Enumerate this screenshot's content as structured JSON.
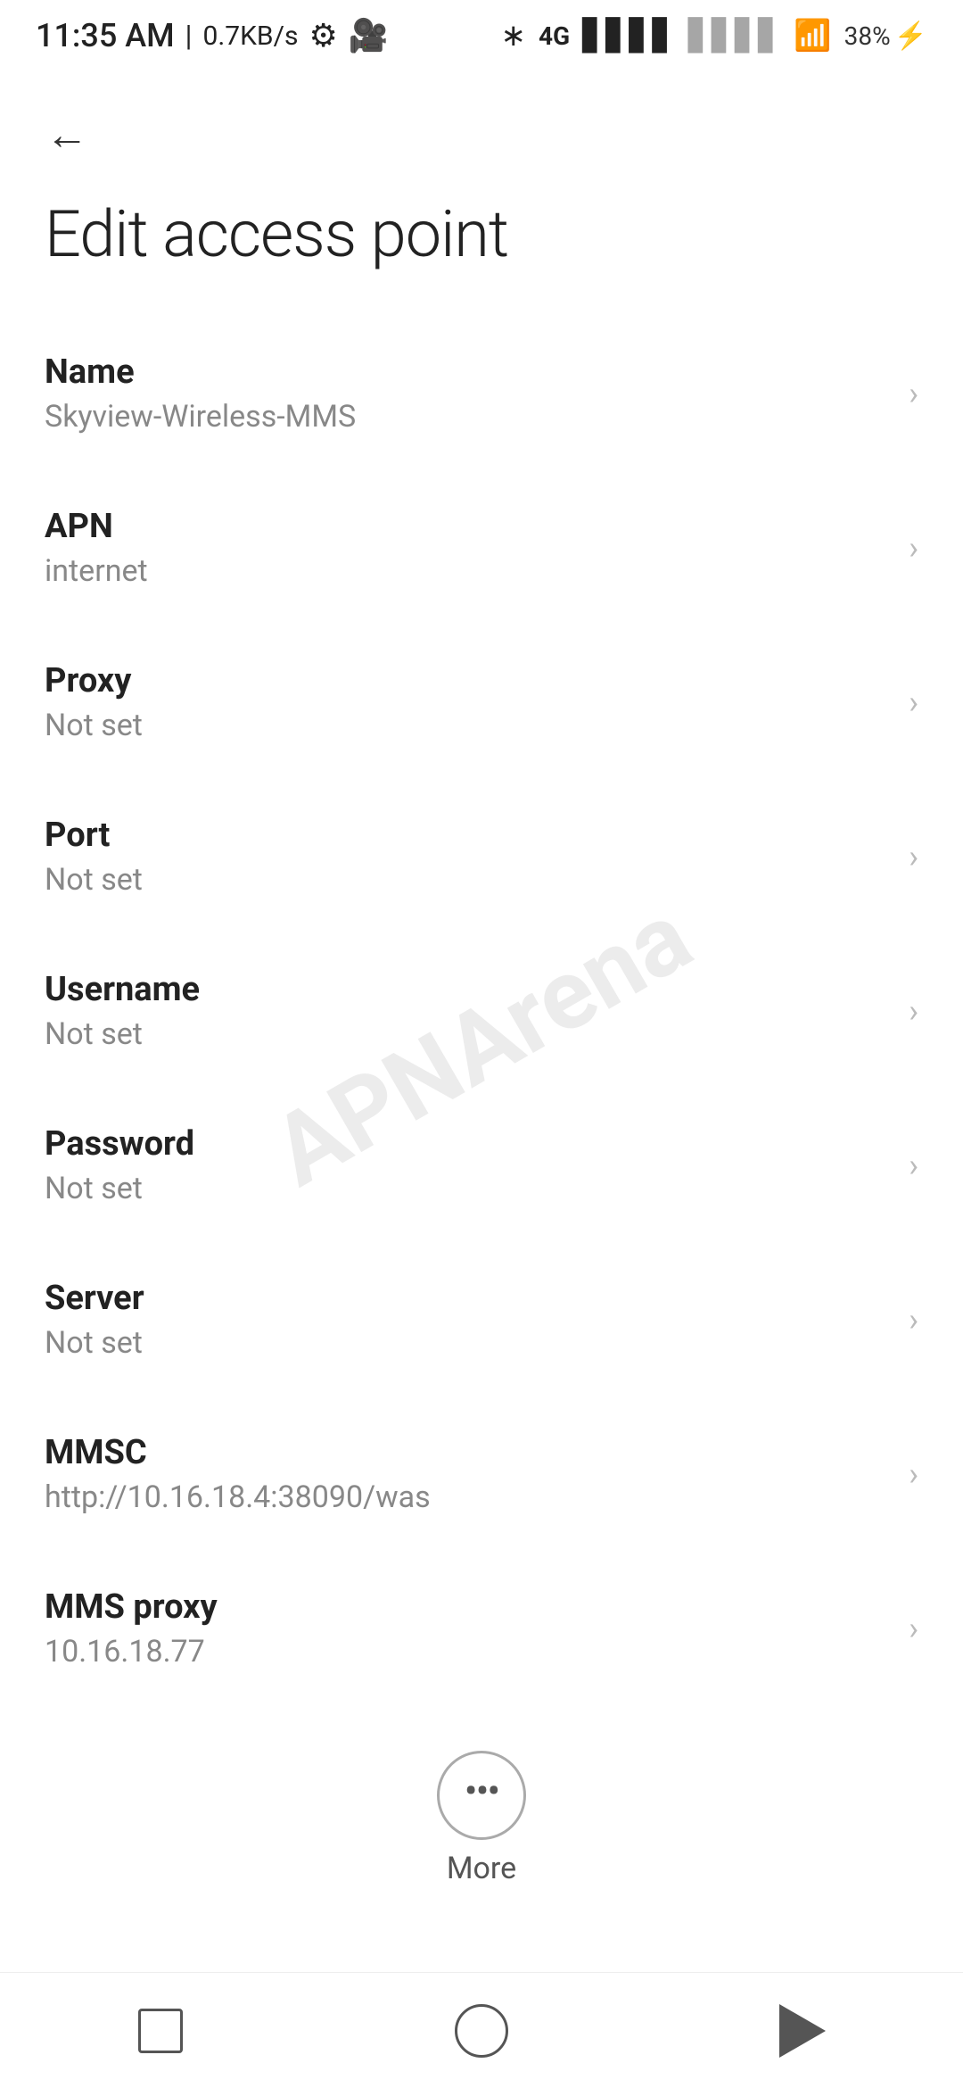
{
  "statusBar": {
    "time": "11:35 AM",
    "separator": "|",
    "speed": "0.7KB/s"
  },
  "page": {
    "title": "Edit access point",
    "backLabel": "←"
  },
  "settings": [
    {
      "label": "Name",
      "value": "Skyview-Wireless-MMS"
    },
    {
      "label": "APN",
      "value": "internet"
    },
    {
      "label": "Proxy",
      "value": "Not set"
    },
    {
      "label": "Port",
      "value": "Not set"
    },
    {
      "label": "Username",
      "value": "Not set"
    },
    {
      "label": "Password",
      "value": "Not set"
    },
    {
      "label": "Server",
      "value": "Not set"
    },
    {
      "label": "MMSC",
      "value": "http://10.16.18.4:38090/was"
    },
    {
      "label": "MMS proxy",
      "value": "10.16.18.77"
    }
  ],
  "more": {
    "label": "More"
  },
  "bottomNav": {
    "square": "recent-apps-icon",
    "circle": "home-icon",
    "triangle": "back-icon"
  },
  "battery": {
    "percent": "38"
  }
}
